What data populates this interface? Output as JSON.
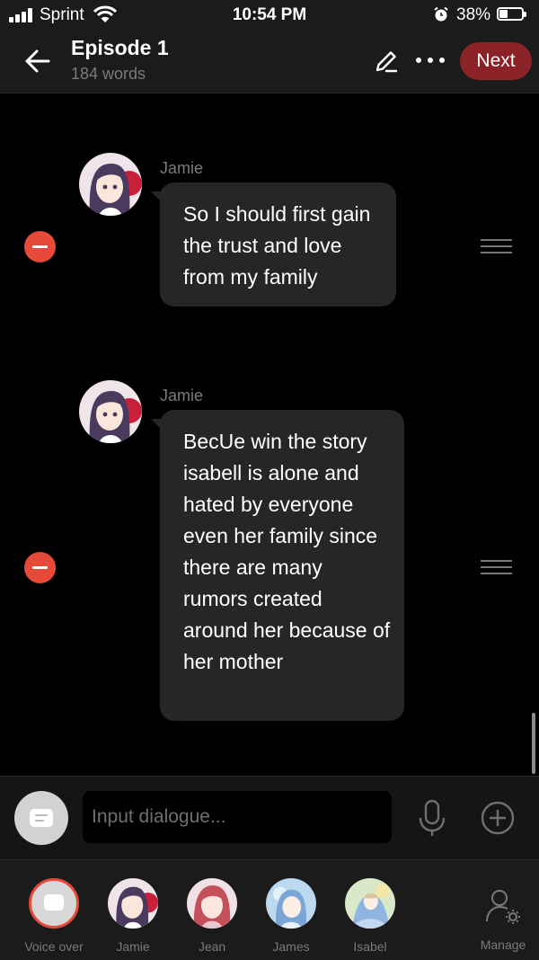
{
  "status": {
    "carrier": "Sprint",
    "time": "10:54 PM",
    "battery": "38%"
  },
  "header": {
    "title": "Episode 1",
    "subtitle": "184 words",
    "next_label": "Next"
  },
  "messages": [
    {
      "speaker": "Jamie",
      "text": "So I should first gain the trust and love from my family"
    },
    {
      "speaker": "Jamie",
      "text": "BecUe win the story isabell is alone and hated by everyone even her family since there are many rumors created around her because of her mother"
    }
  ],
  "input": {
    "placeholder": "Input dialogue..."
  },
  "characters": [
    {
      "label": "Voice over"
    },
    {
      "label": "Jamie"
    },
    {
      "label": "Jean"
    },
    {
      "label": "James"
    },
    {
      "label": "Isabel"
    }
  ],
  "manage_label": "Manage",
  "colors": {
    "accent": "#8a2227",
    "remove": "#e74a3b",
    "bubble": "#262626",
    "muted": "#7a7a7a"
  }
}
